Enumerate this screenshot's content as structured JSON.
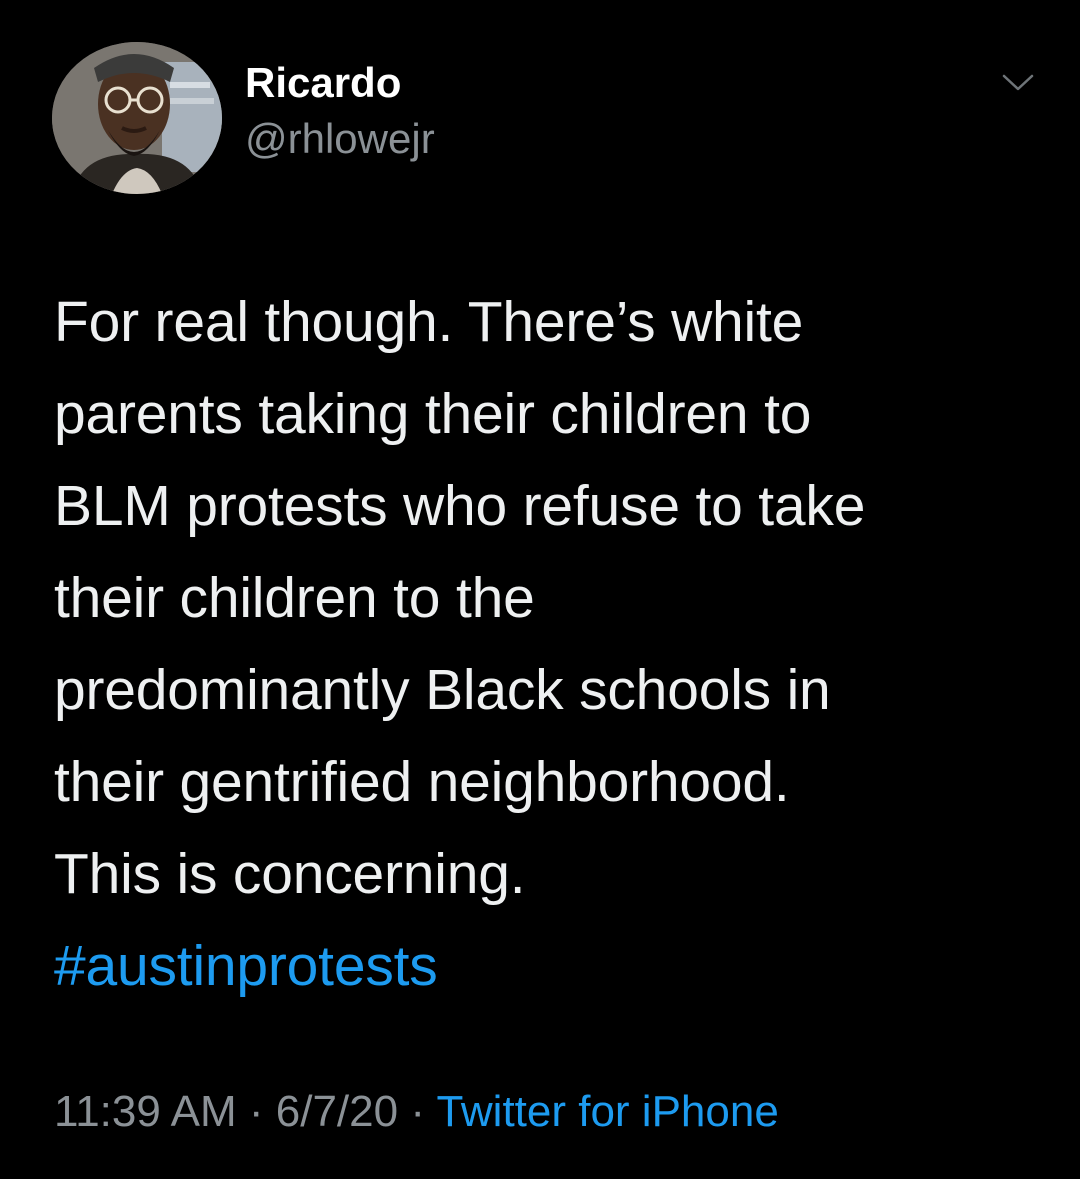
{
  "tweet": {
    "author": {
      "display_name": "Ricardo",
      "handle": "@rhlowejr"
    },
    "menu_icon": "chevron-down-icon",
    "body_lines": [
      "For real though. There’s white",
      "parents taking their children to",
      "BLM protests who refuse to take",
      "their children to the",
      "predominantly Black schools in",
      "their gentrified neighborhood.",
      "This is concerning."
    ],
    "hashtag": "#austinprotests",
    "time": "11:39 AM",
    "separator": "·",
    "date": "6/7/20",
    "source": "Twitter for iPhone"
  },
  "colors": {
    "background": "#000000",
    "primary_text": "#eef0f1",
    "secondary_text": "#8b9196",
    "accent": "#1d9bf0"
  }
}
